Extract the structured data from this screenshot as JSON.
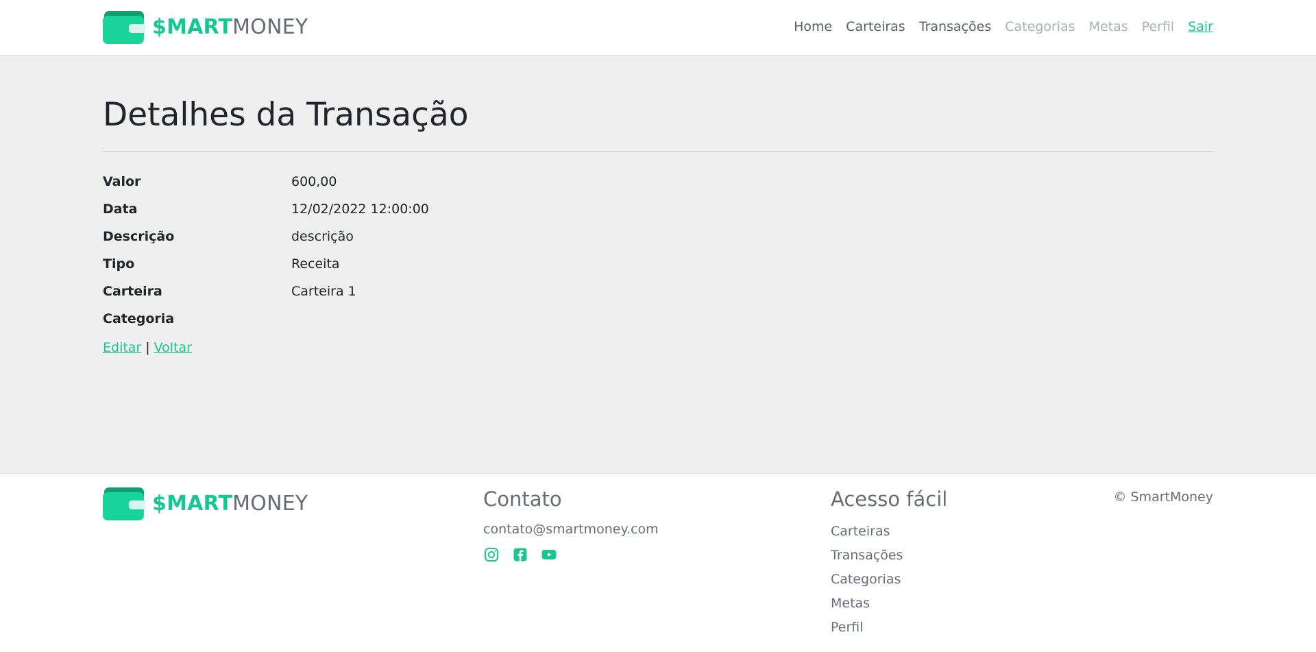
{
  "brand": {
    "smart": "$MART",
    "money": "MONEY"
  },
  "nav": {
    "items": [
      {
        "label": "Home",
        "style": "normal"
      },
      {
        "label": "Carteiras",
        "style": "normal"
      },
      {
        "label": "Transações",
        "style": "normal"
      },
      {
        "label": "Categorias",
        "style": "muted"
      },
      {
        "label": "Metas",
        "style": "muted"
      },
      {
        "label": "Perfil",
        "style": "muted"
      },
      {
        "label": "Sair",
        "style": "link"
      }
    ]
  },
  "page": {
    "title": "Detalhes da Transação"
  },
  "details": [
    {
      "term": "Valor",
      "value": "600,00"
    },
    {
      "term": "Data",
      "value": "12/02/2022 12:00:00"
    },
    {
      "term": "Descrição",
      "value": "descrição"
    },
    {
      "term": "Tipo",
      "value": "Receita"
    },
    {
      "term": "Carteira",
      "value": "Carteira 1"
    },
    {
      "term": "Categoria",
      "value": ""
    }
  ],
  "actions": {
    "edit": "Editar",
    "separator": "|",
    "back": "Voltar"
  },
  "footer": {
    "contact_heading": "Contato",
    "email": "contato@smartmoney.com",
    "social_icons": [
      "instagram-icon",
      "facebook-icon",
      "youtube-icon"
    ],
    "quick_heading": "Acesso fácil",
    "quick_links": [
      "Carteiras",
      "Transações",
      "Categorias",
      "Metas",
      "Perfil"
    ],
    "copyright": "© SmartMoney"
  },
  "colors": {
    "accent": "#16c794",
    "text": "#212529",
    "muted": "#666d74",
    "background": "#efefef"
  }
}
